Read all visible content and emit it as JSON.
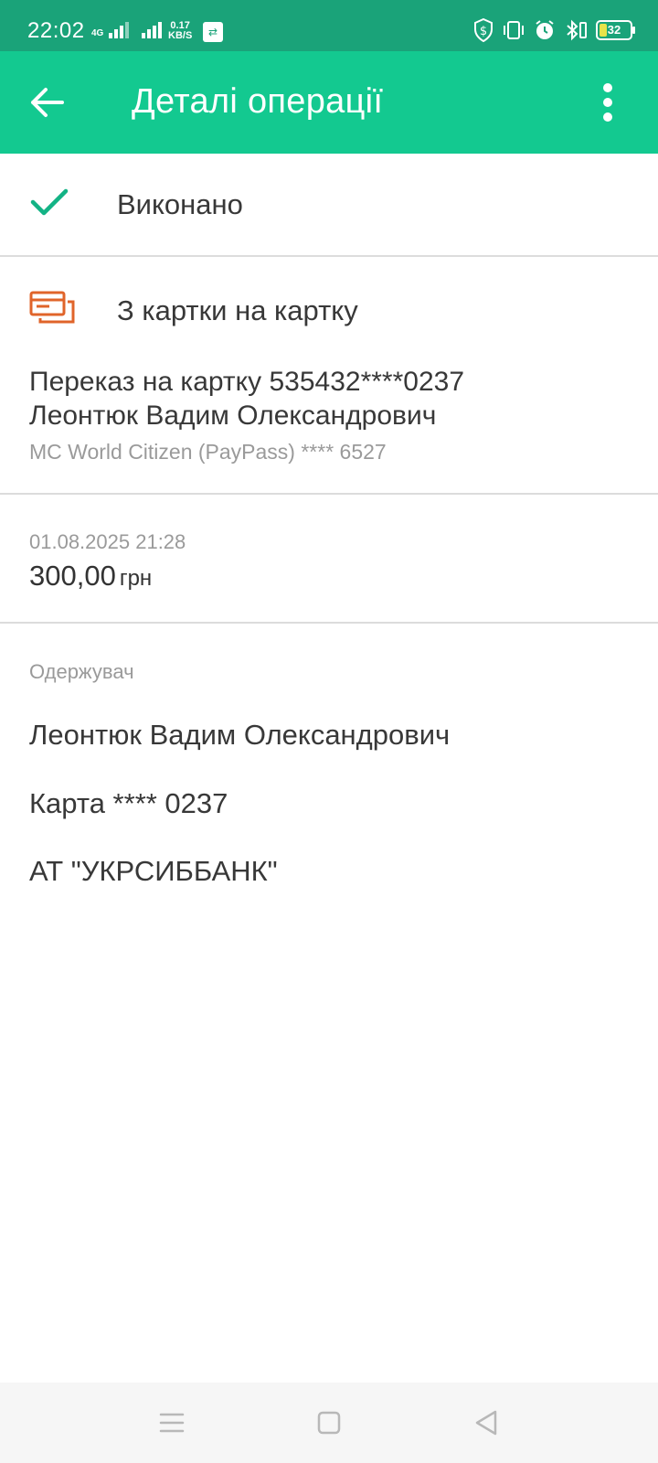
{
  "status_bar": {
    "time": "22:02",
    "network_label": "4G",
    "speed_value": "0.17",
    "speed_unit": "KB/S",
    "battery": "32",
    "icons": [
      "signal-icon",
      "data-swap-icon",
      "shield-dollar-icon",
      "vibrate-icon",
      "alarm-icon",
      "bluetooth-icon",
      "battery-icon"
    ]
  },
  "header": {
    "title": "Деталі операції",
    "background": "#13c990"
  },
  "status": {
    "label": "Виконано",
    "icon": "check-icon",
    "icon_color": "#13b385"
  },
  "operation": {
    "type_label": "З картки на картку",
    "type_icon": "card-transfer-icon",
    "icon_color": "#e0642a",
    "description_line1": "Переказ на картку 535432****0237",
    "description_line2": "Леонтюк Вадим Олександрович",
    "source_card": "MC World Citizen (PayPass) **** 6527"
  },
  "transaction": {
    "datetime": "01.08.2025 21:28",
    "amount": "300,00",
    "currency": "грн"
  },
  "recipient": {
    "heading": "Одержувач",
    "name": "Леонтюк Вадим Олександрович",
    "card": "Карта **** 0237",
    "bank": "АТ \"УКРСИББАНК\""
  },
  "nav_bar": {
    "icons": [
      "menu-icon",
      "home-icon",
      "back-triangle-icon"
    ]
  }
}
